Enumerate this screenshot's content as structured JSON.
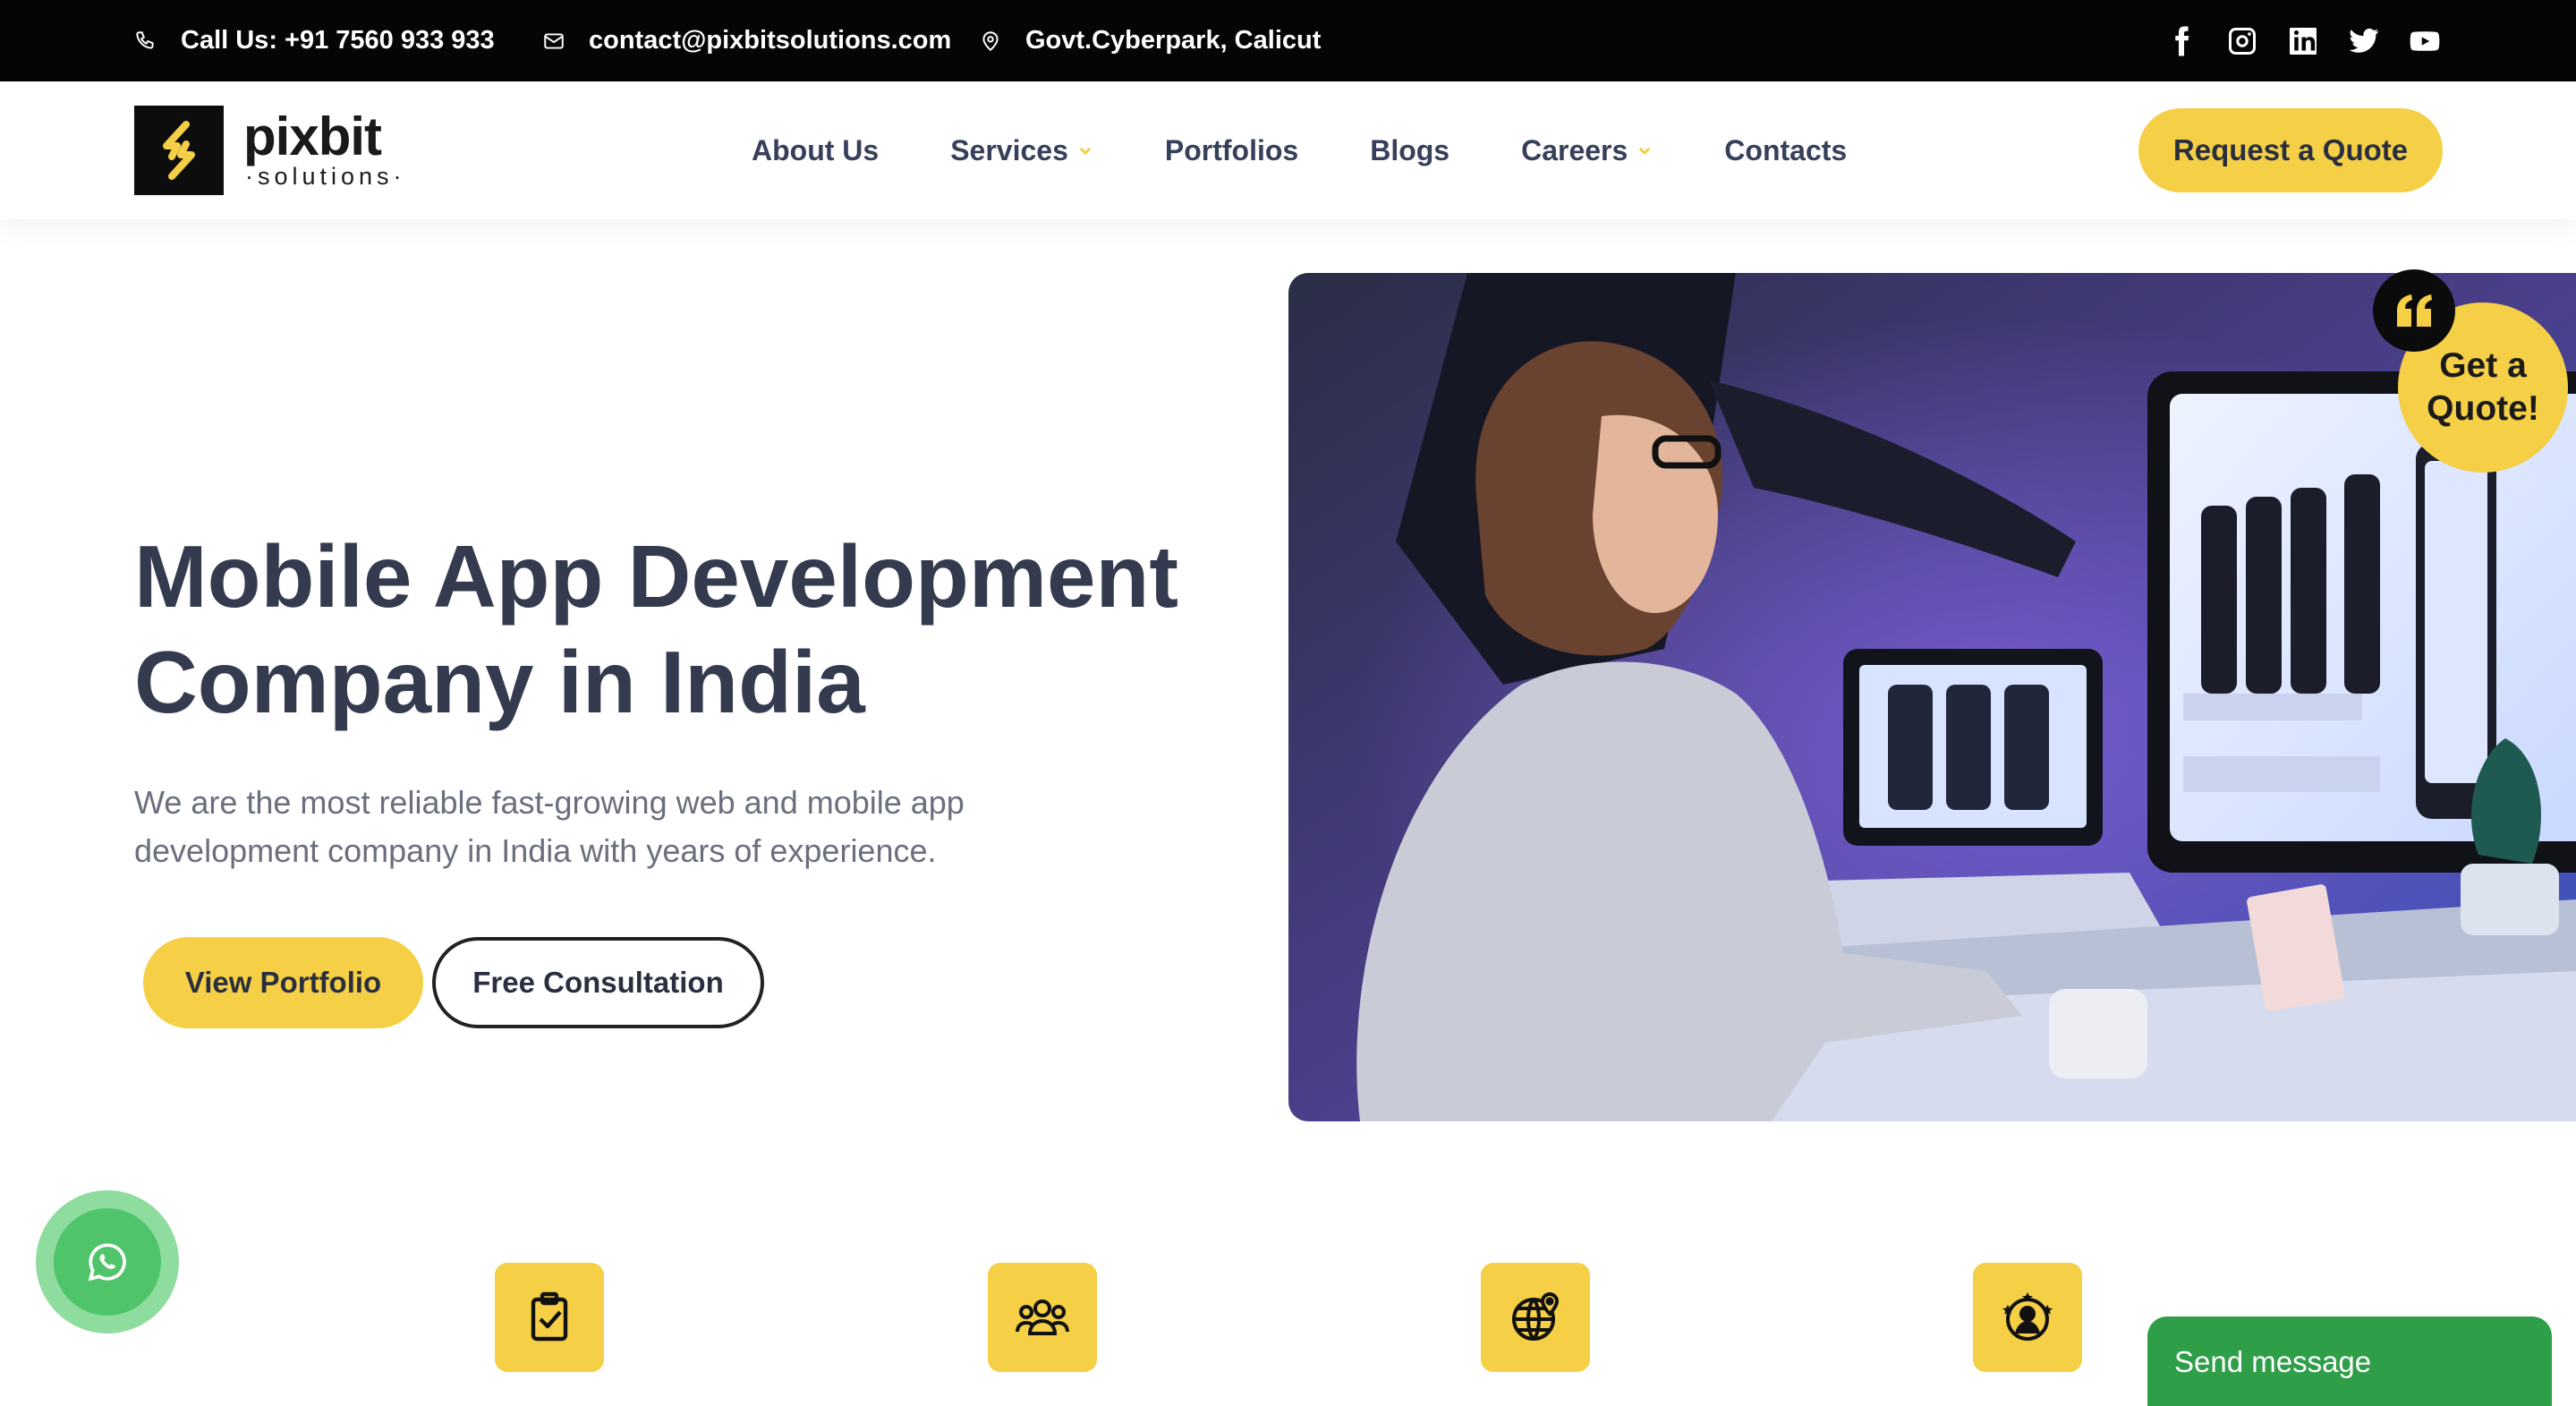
{
  "topbar": {
    "phone": "Call Us: +91 7560 933 933",
    "email": "contact@pixbitsolutions.com",
    "location": "Govt.Cyberpark, Calicut",
    "socials": [
      "facebook-icon",
      "instagram-icon",
      "linkedin-icon",
      "twitter-icon",
      "youtube-icon"
    ]
  },
  "nav": {
    "logo_word": "pixbit",
    "logo_sub": "·solutions·",
    "items": [
      {
        "label": "About Us",
        "dropdown": false
      },
      {
        "label": "Services",
        "dropdown": true
      },
      {
        "label": "Portfolios",
        "dropdown": false
      },
      {
        "label": "Blogs",
        "dropdown": false
      },
      {
        "label": "Careers",
        "dropdown": true
      },
      {
        "label": "Contacts",
        "dropdown": false
      }
    ],
    "cta": "Request a Quote"
  },
  "hero": {
    "title_line1": "Mobile App Development",
    "title_line2": "Company in India",
    "description": "We are the most reliable fast-growing web and mobile app development company in India with years of experience.",
    "primary_button": "View Portfolio",
    "secondary_button": "Free Consultation"
  },
  "badge": {
    "line1": "Get a",
    "line2": "Quote!"
  },
  "features": [
    "clipboard-check-icon",
    "team-icon",
    "globe-location-icon",
    "award-person-icon"
  ],
  "chat": {
    "send_message": "Send message"
  },
  "colors": {
    "accent": "#f5cf46",
    "topbar": "#050505",
    "heading": "#343b4e",
    "whatsapp": "#4fc46a",
    "send_message": "#2e9e48"
  }
}
